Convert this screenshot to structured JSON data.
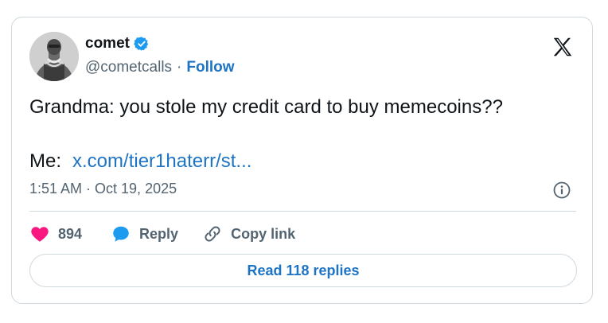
{
  "author": {
    "name": "comet",
    "handle": "@cometcalls",
    "separator": "·",
    "follow_label": "Follow"
  },
  "tweet": {
    "line1": "Grandma: you stole my credit card to buy memecoins??",
    "line2_prefix": "Me:",
    "link_text": "x.com/tier1haterr/st..."
  },
  "meta": {
    "timestamp": "1:51 AM · Oct 19, 2025"
  },
  "actions": {
    "likes": "894",
    "reply_label": "Reply",
    "copy_label": "Copy link"
  },
  "footer": {
    "read_replies_label": "Read 118 replies"
  },
  "colors": {
    "link": "#1d74c5",
    "like": "#f91880",
    "reply_bubble": "#1d9bf0",
    "verified": "#1d9bf0",
    "muted_text": "#536471",
    "border": "#cfd9de"
  },
  "icons": [
    "verified-badge-icon",
    "x-logo-icon",
    "info-icon",
    "heart-icon",
    "reply-bubble-icon",
    "link-chain-icon"
  ]
}
